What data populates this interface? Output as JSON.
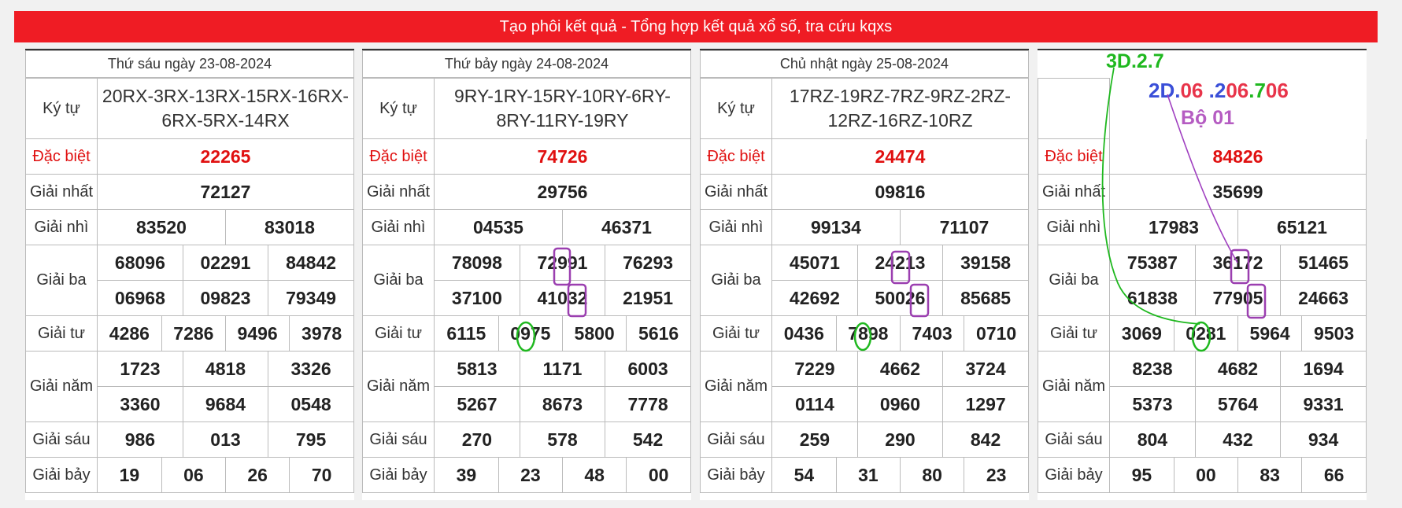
{
  "header": {
    "title": "Tạo phôi kết quả - Tổng hợp kết quả xổ số, tra cứu kqxs"
  },
  "labels": {
    "ky_tu": "Ký tự",
    "dac_biet": "Đặc biệt",
    "giai_nhat": "Giải nhất",
    "giai_nhi": "Giải nhì",
    "giai_ba": "Giải ba",
    "giai_tu": "Giải tư",
    "giai_nam": "Giải năm",
    "giai_sau": "Giải sáu",
    "giai_bay": "Giải bảy"
  },
  "panels": [
    {
      "date": "Thứ sáu ngày 23-08-2024",
      "kytu": [
        "20RX-3RX-13RX-15RX-16RX-",
        "6RX-5RX-14RX"
      ],
      "db": "22265",
      "g1": "72127",
      "g2": [
        "83520",
        "83018"
      ],
      "g3": [
        "68096",
        "02291",
        "84842",
        "06968",
        "09823",
        "79349"
      ],
      "g4": [
        "4286",
        "7286",
        "9496",
        "3978"
      ],
      "g5": [
        "1723",
        "4818",
        "3326",
        "3360",
        "9684",
        "0548"
      ],
      "g6": [
        "986",
        "013",
        "795"
      ],
      "g7": [
        "19",
        "06",
        "26",
        "70"
      ]
    },
    {
      "date": "Thứ bảy ngày 24-08-2024",
      "kytu": [
        "9RY-1RY-15RY-10RY-6RY-",
        "8RY-11RY-19RY"
      ],
      "db": "74726",
      "g1": "29756",
      "g2": [
        "04535",
        "46371"
      ],
      "g3": [
        "78098",
        "72991",
        "76293",
        "37100",
        "41032",
        "21951"
      ],
      "g4": [
        "6115",
        "0975",
        "5800",
        "5616"
      ],
      "g5": [
        "5813",
        "1171",
        "6003",
        "5267",
        "8673",
        "7778"
      ],
      "g6": [
        "270",
        "578",
        "542"
      ],
      "g7": [
        "39",
        "23",
        "48",
        "00"
      ]
    },
    {
      "date": "Chủ nhật ngày 25-08-2024",
      "kytu": [
        "17RZ-19RZ-7RZ-9RZ-2RZ-",
        "12RZ-16RZ-10RZ"
      ],
      "db": "24474",
      "g1": "09816",
      "g2": [
        "99134",
        "71107"
      ],
      "g3": [
        "45071",
        "24213",
        "39158",
        "42692",
        "50026",
        "85685"
      ],
      "g4": [
        "0436",
        "7898",
        "7403",
        "0710"
      ],
      "g5": [
        "7229",
        "4662",
        "3724",
        "0114",
        "0960",
        "1297"
      ],
      "g6": [
        "259",
        "290",
        "842"
      ],
      "g7": [
        "54",
        "31",
        "80",
        "23"
      ]
    },
    {
      "date": "",
      "kytu": [
        "",
        ""
      ],
      "db": "84826",
      "g1": "35699",
      "g2": [
        "17983",
        "65121"
      ],
      "g3": [
        "75387",
        "36172",
        "51465",
        "61838",
        "77905",
        "24663"
      ],
      "g4": [
        "3069",
        "0281",
        "5964",
        "9503"
      ],
      "g5": [
        "8238",
        "4682",
        "1694",
        "5373",
        "5764",
        "9331"
      ],
      "g6": [
        "804",
        "432",
        "934"
      ],
      "g7": [
        "95",
        "00",
        "83",
        "66"
      ]
    }
  ],
  "annotations": {
    "line1": "3D.2.7",
    "line2_a": "2D.",
    "line2_b": "06",
    "line2_c": " .2",
    "line2_d": "06",
    "line2_e": ".7",
    "line2_f": "06",
    "line3": "Bộ 01",
    "colors": {
      "green": "#1fb81f",
      "blue": "#3a4fd8",
      "red": "#e8344a",
      "purple": "#b55cc2"
    }
  }
}
